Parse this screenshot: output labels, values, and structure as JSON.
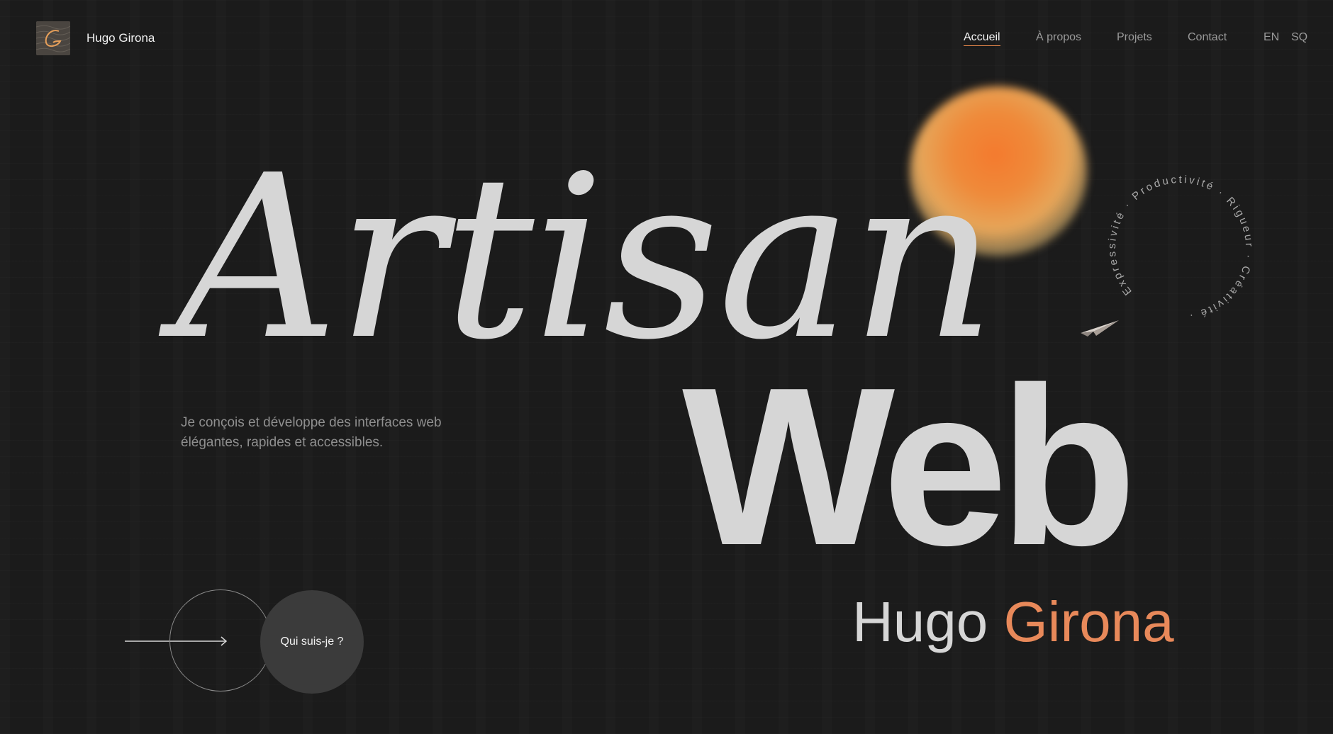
{
  "header": {
    "brand": "Hugo Girona",
    "nav": [
      {
        "label": "Accueil",
        "active": true
      },
      {
        "label": "À propos",
        "active": false
      },
      {
        "label": "Projets",
        "active": false
      },
      {
        "label": "Contact",
        "active": false
      }
    ],
    "languages": [
      "EN",
      "SQ"
    ]
  },
  "hero": {
    "title_line1": "Artisan",
    "title_line2": "Web",
    "name_first": "Hugo",
    "name_last": "Girona",
    "tagline": "Je conçois et développe des interfaces web élégantes, rapides et accessibles.",
    "circular_text": "Expressivité · Productivité · Rigueur · Créativité ·",
    "cta_label": "Qui suis-je ?"
  },
  "colors": {
    "background": "#1b1b1b",
    "text": "#d6d6d6",
    "accent": "#e8895a",
    "sun": "#f47a2e"
  },
  "icons": {
    "logo": "logo-mark-icon",
    "plane": "paper-plane-icon",
    "arrow": "arrow-right-icon"
  }
}
